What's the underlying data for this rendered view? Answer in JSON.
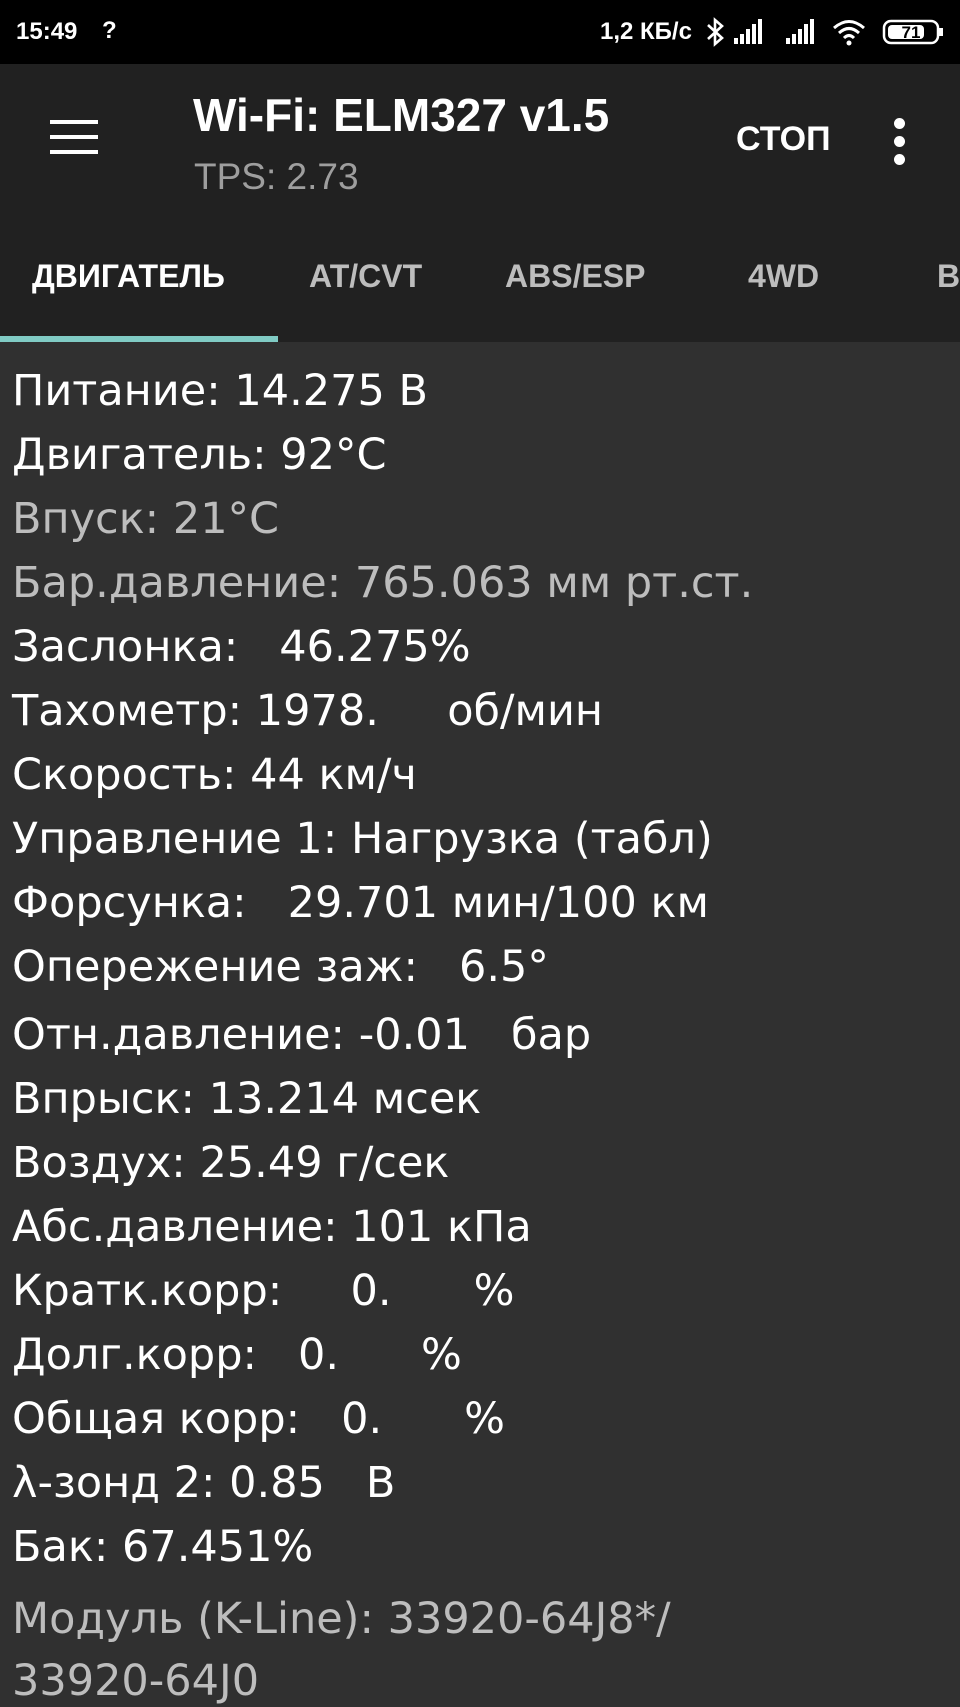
{
  "status_bar": {
    "time": "15:49",
    "notif_glyph": "?",
    "net_speed": "1,2 КБ/с",
    "battery": "71",
    "icons": [
      "bluetooth-icon",
      "signal-icon",
      "signal-icon",
      "wifi-icon",
      "battery-icon"
    ]
  },
  "toolbar": {
    "title": "Wi-Fi: ELM327 v1.5",
    "subtitle": "TPS: 2.73",
    "stop_label": "СТОП"
  },
  "tabs": [
    {
      "label": "ДВИГАТЕЛЬ",
      "active": true
    },
    {
      "label": "AT/CVT",
      "active": false
    },
    {
      "label": "ABS/ESP",
      "active": false
    },
    {
      "label": "4WD",
      "active": false
    },
    {
      "label": "B",
      "active": false
    }
  ],
  "colors": {
    "accent": "#80cbc4",
    "background": "#303030",
    "toolbar": "#212121",
    "text_primary": "#ffffff",
    "text_dim": "#bdbdbd"
  },
  "readings": [
    {
      "text": "Питание: 14.275 В",
      "dim": false
    },
    {
      "text": "Двигатель: 92°С",
      "dim": false
    },
    {
      "text": "Впуск: 21°С",
      "dim": true
    },
    {
      "text": "Бар.давление: 765.063 мм рт.ст.",
      "dim": true
    },
    {
      "text": "Заслонка:   46.275%",
      "dim": false
    },
    {
      "text": "Тахометр: 1978.     об/мин",
      "dim": false
    },
    {
      "text": "Скорость: 44 км/ч",
      "dim": false
    },
    {
      "text": "Управление 1: Нагрузка (табл)",
      "dim": false
    },
    {
      "text": "Форсунка:   29.701 мин/100 км",
      "dim": false
    },
    {
      "text": "Опережение заж:   6.5°",
      "dim": false
    },
    {
      "text": "Отн.давление: -0.01   бар",
      "dim": false
    },
    {
      "text": "Впрыск: 13.214 мсек",
      "dim": false
    },
    {
      "text": "Воздух: 25.49 г/сек",
      "dim": false
    },
    {
      "text": "Абс.давление: 101 кПа",
      "dim": false
    },
    {
      "text": "Кратк.корр:     0.      %",
      "dim": false
    },
    {
      "text": "Долг.корр:   0.      %",
      "dim": false
    },
    {
      "text": "Общая корр:   0.      %",
      "dim": false
    },
    {
      "text": "λ-зонд 2: 0.85   В",
      "dim": false
    },
    {
      "text": "Бак: 67.451%",
      "dim": false
    },
    {
      "text": "Модуль (K-Line): 33920-64J8*/",
      "dim": true
    },
    {
      "text": "33920-64J0",
      "dim": true
    }
  ]
}
